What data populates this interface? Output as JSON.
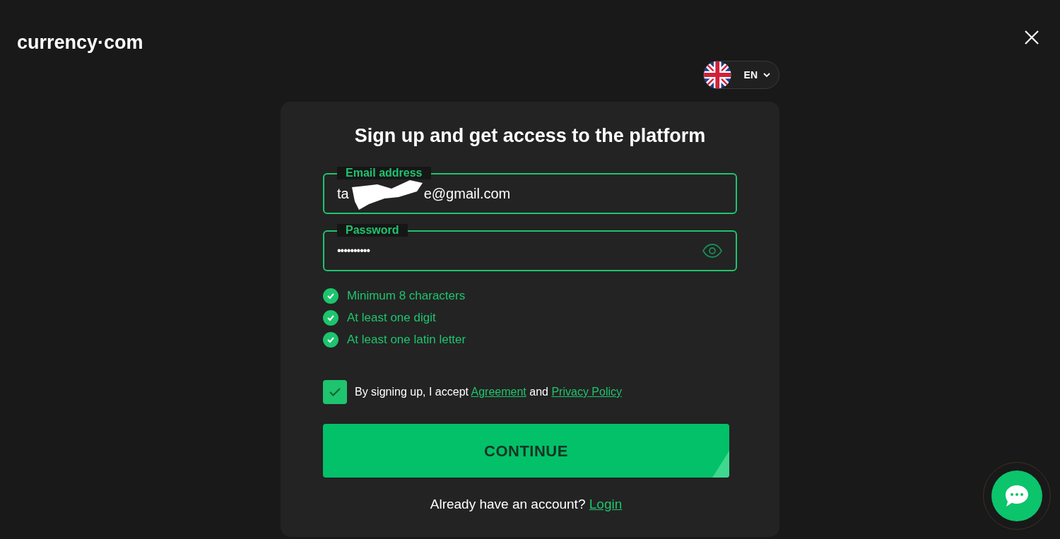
{
  "header": {
    "logo": "currency·com",
    "language": "EN"
  },
  "form": {
    "title": "Sign up and get access to the platform",
    "email": {
      "label": "Email address",
      "value_start": "ta",
      "value_end": "e@gmail.com",
      "focused": true
    },
    "password": {
      "label": "Password",
      "value": "••••••••••",
      "focused": true
    },
    "rules": [
      {
        "text": "Minimum 8 characters",
        "met": true
      },
      {
        "text": "At least one digit",
        "met": true
      },
      {
        "text": "At least one latin letter",
        "met": true
      }
    ],
    "consent": {
      "checked": true,
      "text": "By signing up, I accept",
      "link_1": "Agreement",
      "joiner": "and",
      "link_2": "Privacy Policy"
    },
    "submit": "CONTINUE",
    "footer": {
      "text": "Already have an account?",
      "link": "Login"
    }
  }
}
